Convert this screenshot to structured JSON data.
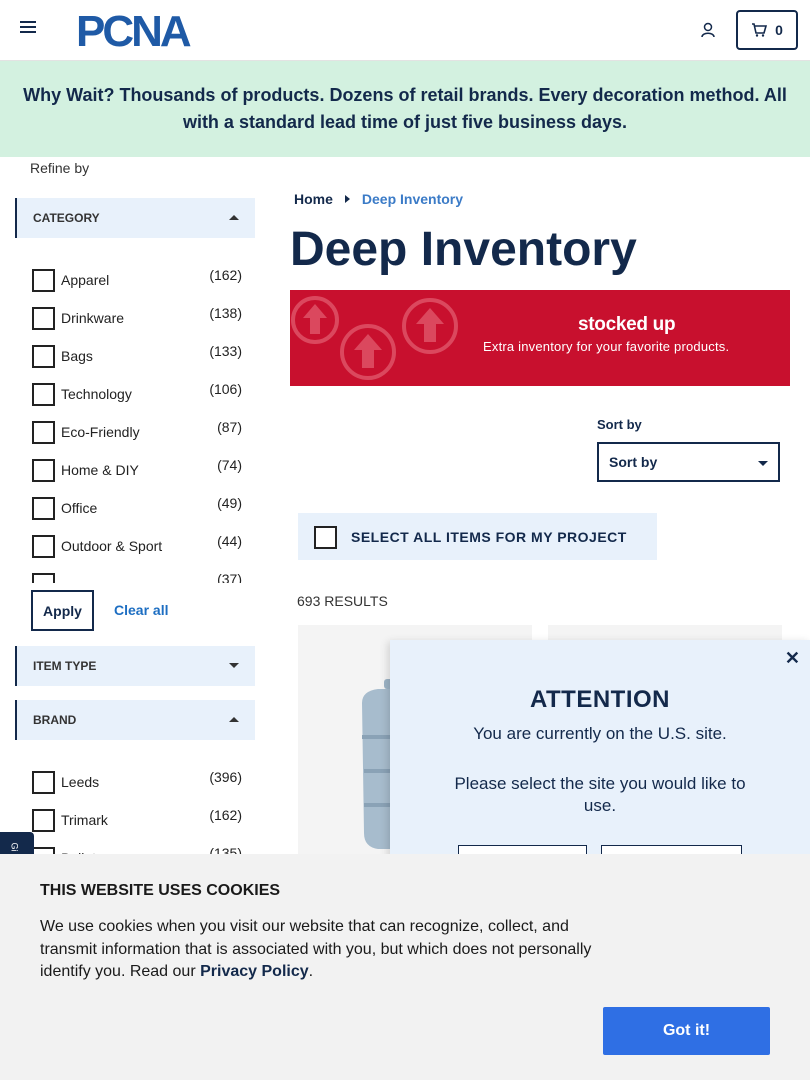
{
  "header": {
    "logo_text": "PCNA",
    "cart_count": "0"
  },
  "promo": {
    "text": "Why Wait? Thousands of products. Dozens of retail brands. Every decoration method. All with a standard lead time of just five business days."
  },
  "sidebar": {
    "refine_label": "Refine by",
    "category": {
      "title": "CATEGORY",
      "items": [
        {
          "label": "Apparel",
          "count": "(162)"
        },
        {
          "label": "Drinkware",
          "count": "(138)"
        },
        {
          "label": "Bags",
          "count": "(133)"
        },
        {
          "label": "Technology",
          "count": "(106)"
        },
        {
          "label": "Eco-Friendly",
          "count": "(87)"
        },
        {
          "label": "Home & DIY",
          "count": "(74)"
        },
        {
          "label": "Office",
          "count": "(49)"
        },
        {
          "label": "Outdoor & Sport",
          "count": "(44)"
        },
        {
          "label": "",
          "count": "(37)"
        }
      ]
    },
    "apply_label": "Apply",
    "clear_label": "Clear all",
    "item_type": {
      "title": "ITEM TYPE"
    },
    "brand": {
      "title": "BRAND",
      "items": [
        {
          "label": "Leeds",
          "count": "(396)"
        },
        {
          "label": "Trimark",
          "count": "(162)"
        },
        {
          "label": "Bullet",
          "count": "(135)"
        }
      ]
    }
  },
  "breadcrumb": {
    "home": "Home",
    "current": "Deep Inventory"
  },
  "page_title": "Deep Inventory",
  "banner": {
    "brand": "stocked up",
    "tagline": "Extra inventory for your favorite products."
  },
  "sort": {
    "label": "Sort by",
    "selected": "Sort by"
  },
  "select_all_label": "SELECT ALL ITEMS FOR MY PROJECT",
  "results_text": "693 RESULTS",
  "modal": {
    "title": "ATTENTION",
    "message1": "You are currently on the U.S. site.",
    "message2": "Please select the site you would like to use."
  },
  "side_tab_text": "Gi",
  "cookie": {
    "title": "THIS WEBSITE USES COOKIES",
    "text": "We use cookies when you visit our website that can recognize, collect, and transmit information that is associated with you, but which does not personally identify you. Read our",
    "link": "Privacy Policy",
    "period": ".",
    "button": "Got it!"
  },
  "colors": {
    "navy": "#13294b",
    "promo_bg": "#d3f1e0",
    "banner_red": "#c8102e",
    "accent_blue": "#2f6fe4"
  }
}
